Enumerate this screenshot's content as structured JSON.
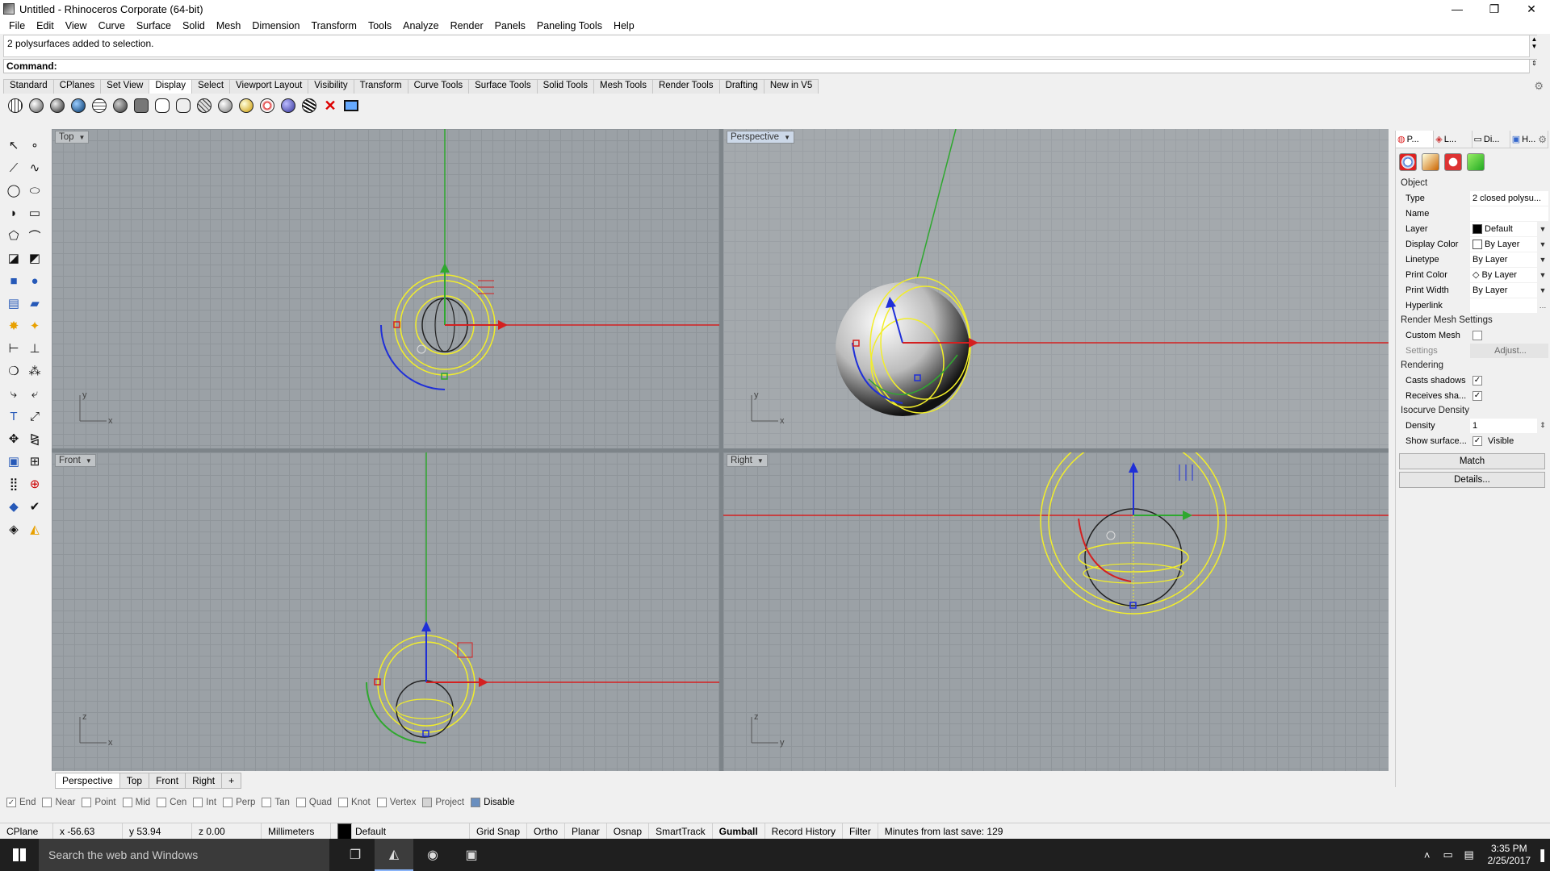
{
  "window": {
    "title": "Untitled - Rhinoceros Corporate (64-bit)",
    "minimize": "—",
    "restore": "❐",
    "close": "✕"
  },
  "menu": [
    "File",
    "Edit",
    "View",
    "Curve",
    "Surface",
    "Solid",
    "Mesh",
    "Dimension",
    "Transform",
    "Tools",
    "Analyze",
    "Render",
    "Panels",
    "Paneling Tools",
    "Help"
  ],
  "history": {
    "text": "2 polysurfaces added to selection."
  },
  "command": {
    "label": "Command:",
    "value": ""
  },
  "toolbar_tabs": [
    "Standard",
    "CPlanes",
    "Set View",
    "Display",
    "Select",
    "Viewport Layout",
    "Visibility",
    "Transform",
    "Curve Tools",
    "Surface Tools",
    "Solid Tools",
    "Mesh Tools",
    "Render Tools",
    "Drafting",
    "New in V5"
  ],
  "active_toolbar_tab": "Display",
  "viewports": {
    "top": {
      "label": "Top",
      "axis_a": "y",
      "axis_b": "x"
    },
    "perspective": {
      "label": "Perspective",
      "axis_a": "y",
      "axis_b": "x"
    },
    "front": {
      "label": "Front",
      "axis_a": "z",
      "axis_b": "x"
    },
    "right": {
      "label": "Right",
      "axis_a": "z",
      "axis_b": "y"
    }
  },
  "viewport_tabs": [
    "Perspective",
    "Top",
    "Front",
    "Right",
    "+"
  ],
  "osnaps": [
    {
      "label": "End",
      "checked": true
    },
    {
      "label": "Near",
      "checked": false
    },
    {
      "label": "Point",
      "checked": false
    },
    {
      "label": "Mid",
      "checked": false
    },
    {
      "label": "Cen",
      "checked": false
    },
    {
      "label": "Int",
      "checked": false
    },
    {
      "label": "Perp",
      "checked": false
    },
    {
      "label": "Tan",
      "checked": false
    },
    {
      "label": "Quad",
      "checked": false
    },
    {
      "label": "Knot",
      "checked": false
    },
    {
      "label": "Vertex",
      "checked": false
    },
    {
      "label": "Project",
      "checked": false
    },
    {
      "label": "Disable",
      "checked": false
    }
  ],
  "status": {
    "cplane": "CPlane",
    "x": "x -56.63",
    "y": "y 53.94",
    "z": "z 0.00",
    "units": "Millimeters",
    "layer": "Default",
    "grid_snap": "Grid Snap",
    "ortho": "Ortho",
    "planar": "Planar",
    "osnap": "Osnap",
    "smarttrack": "SmartTrack",
    "gumball": "Gumball",
    "record_history": "Record History",
    "filter": "Filter",
    "save_info": "Minutes from last save: 129"
  },
  "panel": {
    "tabs": [
      "P...",
      "L...",
      "Di...",
      "H..."
    ],
    "object_header": "Object",
    "rows": [
      {
        "key": "Type",
        "value": "2 closed polysu..."
      },
      {
        "key": "Name",
        "value": ""
      },
      {
        "key": "Layer",
        "value": "Default"
      },
      {
        "key": "Display Color",
        "value": "By Layer"
      },
      {
        "key": "Linetype",
        "value": "By Layer"
      },
      {
        "key": "Print Color",
        "value": "By Layer"
      },
      {
        "key": "Print Width",
        "value": "By Layer"
      },
      {
        "key": "Hyperlink",
        "value": ""
      }
    ],
    "render_mesh_header": "Render Mesh Settings",
    "custom_mesh": "Custom Mesh",
    "settings": "Settings",
    "adjust": "Adjust...",
    "rendering_header": "Rendering",
    "casts_shadows": "Casts shadows",
    "receives_shadows": "Receives sha...",
    "isocurve_header": "Isocurve Density",
    "density_label": "Density",
    "density_value": "1",
    "show_surface": "Show surface...",
    "visible": "Visible",
    "match": "Match",
    "details": "Details..."
  },
  "taskbar": {
    "search": "Search the web and Windows",
    "time": "3:35 PM",
    "date": "2/25/2017"
  },
  "colors": {
    "x_axis": "#d42020",
    "y_axis": "#2fa82f",
    "z_axis": "#1f2fd8",
    "selection": "#f2ee2a"
  }
}
